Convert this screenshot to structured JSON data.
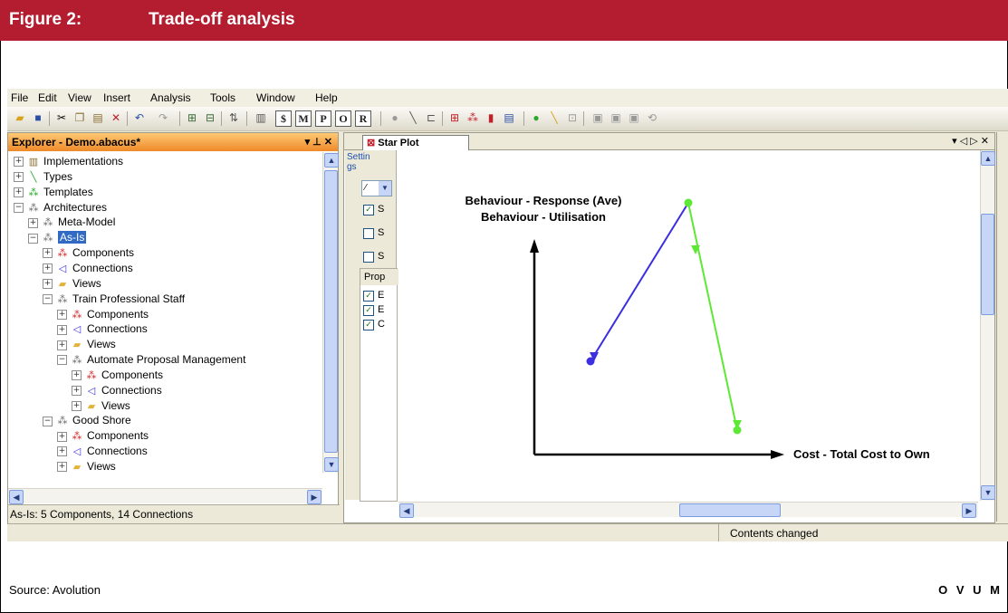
{
  "figure": {
    "label": "Figure 2:",
    "title": "Trade-off analysis",
    "source": "Source: Avolution",
    "brand": "O V U M",
    "header_color": "#b31d2f"
  },
  "menu": [
    "File",
    "Edit",
    "View",
    "Insert",
    "Analysis",
    "Tools",
    "Window",
    "Help"
  ],
  "toolbar": {
    "letter_buttons": [
      "$",
      "M",
      "P",
      "O",
      "R"
    ]
  },
  "explorer": {
    "title": "Explorer - Demo.abacus*",
    "controls": "▾ ⊥ ✕",
    "tree": [
      {
        "label": "Implementations",
        "icon": "implementations-icon",
        "sign": "+"
      },
      {
        "label": "Types",
        "icon": "types-icon",
        "sign": "+"
      },
      {
        "label": "Templates",
        "icon": "templates-icon",
        "sign": "+"
      },
      {
        "label": "Architectures",
        "icon": "architectures-icon",
        "sign": "−"
      },
      {
        "label": "Meta-Model",
        "icon": "model-icon",
        "sign": "+"
      },
      {
        "label": "As-Is",
        "icon": "model-icon",
        "sign": "−"
      },
      {
        "label": "Components",
        "icon": "components-icon",
        "sign": "+"
      },
      {
        "label": "Connections",
        "icon": "connections-icon",
        "sign": "+"
      },
      {
        "label": "Views",
        "icon": "folder-icon",
        "sign": "+"
      },
      {
        "label": "Train Professional Staff",
        "icon": "model-icon",
        "sign": "−"
      },
      {
        "label": "Components",
        "icon": "components-icon",
        "sign": "+"
      },
      {
        "label": "Connections",
        "icon": "connections-icon",
        "sign": "+"
      },
      {
        "label": "Views",
        "icon": "folder-icon",
        "sign": "+"
      },
      {
        "label": "Automate Proposal Management",
        "icon": "model-icon",
        "sign": "−"
      },
      {
        "label": "Components",
        "icon": "components-icon",
        "sign": "+"
      },
      {
        "label": "Connections",
        "icon": "connections-icon",
        "sign": "+"
      },
      {
        "label": "Views",
        "icon": "folder-icon",
        "sign": "+"
      },
      {
        "label": "Good Shore",
        "icon": "model-icon",
        "sign": "−"
      },
      {
        "label": "Components",
        "icon": "components-icon",
        "sign": "+"
      },
      {
        "label": "Connections",
        "icon": "connections-icon",
        "sign": "+"
      },
      {
        "label": "Views",
        "icon": "folder-icon",
        "sign": "+"
      }
    ],
    "status": "As-Is: 5 Components, 14 Connections"
  },
  "document": {
    "tab": "Star Plot",
    "controls": "▾ ◁ ▷ ✕",
    "settings_label": "Settin gs",
    "dropdown_value": "⁄",
    "series_checks": [
      {
        "label": "S",
        "checked": true
      },
      {
        "label": "S",
        "checked": false
      },
      {
        "label": "S",
        "checked": false
      }
    ],
    "prop_label": "Prop",
    "prop_checks": [
      {
        "label": "E",
        "checked": true
      },
      {
        "label": "E",
        "checked": true
      },
      {
        "label": "C",
        "checked": true
      }
    ],
    "plot": {
      "y_label_1": "Behaviour - Response (Ave)",
      "y_label_2": "Behaviour - Utilisation",
      "x_label": "Cost - Total Cost to Own",
      "colors": {
        "blue": "#3b2fe0",
        "green": "#5ee836"
      }
    }
  },
  "status_bar": {
    "text": "Contents changed"
  }
}
